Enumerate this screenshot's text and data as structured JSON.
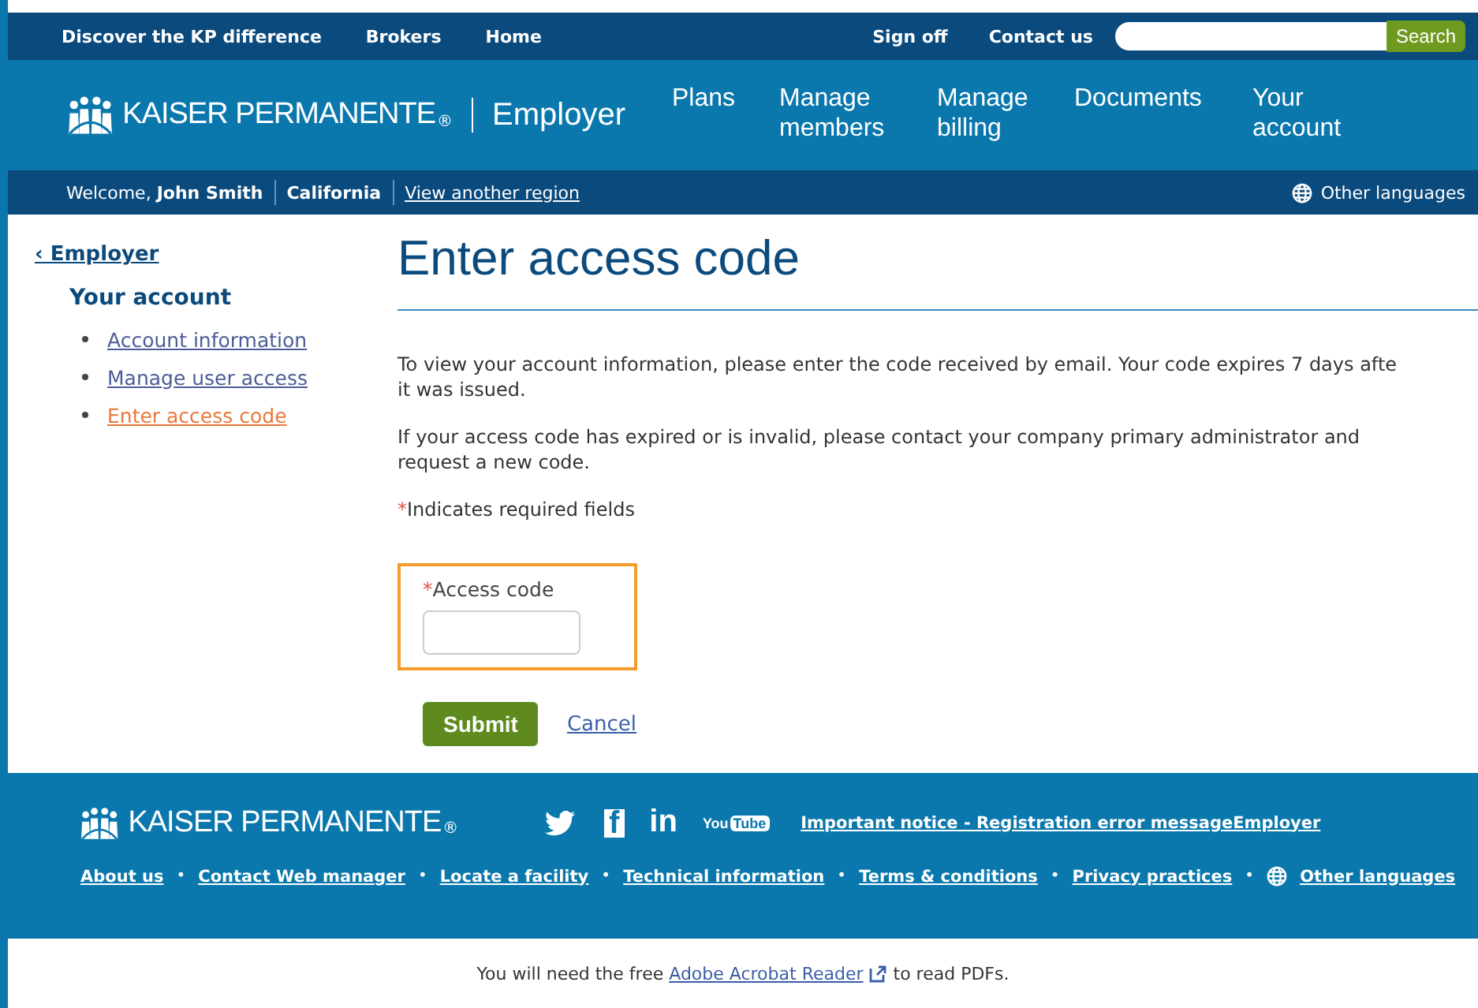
{
  "utility_bar": {
    "left_links": [
      "Discover the KP difference",
      "Brokers",
      "Home"
    ],
    "right_links": [
      "Sign off",
      "Contact us"
    ],
    "search": {
      "button": "Search"
    }
  },
  "header": {
    "brand": "KAISER PERMANENTE",
    "brand_mark": "®",
    "section": "Employer",
    "nav": [
      {
        "label": "Plans"
      },
      {
        "label": "Manage members"
      },
      {
        "label": "Manage billing"
      },
      {
        "label": "Documents"
      },
      {
        "label": "Your account"
      }
    ]
  },
  "welcome_bar": {
    "greeting": "Welcome,",
    "name": "John Smith",
    "region": "California",
    "region_link": "View another region",
    "languages": "Other languages"
  },
  "sidebar": {
    "back": "‹ Employer",
    "heading": "Your account",
    "items": [
      {
        "label": "Account information",
        "selected": false
      },
      {
        "label": "Manage user access",
        "selected": false
      },
      {
        "label": "Enter access code",
        "selected": true
      }
    ]
  },
  "main": {
    "title": "Enter access code",
    "paragraphs": [
      [
        "To view your account information, please enter the code received by email. Your code expires 7 days afte",
        "it was issued."
      ],
      [
        "If your access code has expired or is invalid, please contact your company primary administrator and",
        "request a new code."
      ]
    ],
    "required_note": {
      "mark": "*",
      "text": "Indicates required fields"
    },
    "field": {
      "mark": "*",
      "label": "Access code",
      "highlighted": true
    },
    "submit": "Submit",
    "cancel": "Cancel"
  },
  "footer": {
    "brand": "KAISER PERMANENTE",
    "brand_mark": "®",
    "social": [
      {
        "kind": "twitter"
      },
      {
        "kind": "facebook",
        "label": "f"
      },
      {
        "kind": "linkedin",
        "label": "in"
      },
      {
        "kind": "youtube",
        "label": "You",
        "label2": "Tube"
      }
    ],
    "notice": "Important notice - Registration error messageEmployer",
    "links": [
      "About us",
      "Contact Web manager",
      "Locate a facility",
      "Technical information",
      "Terms & conditions",
      "Privacy practices"
    ],
    "separator": "•",
    "languages": "Other languages"
  },
  "bottom_note": {
    "before": "You will need the free",
    "link": "Adobe Acrobat Reader",
    "after": "to read PDFs."
  }
}
